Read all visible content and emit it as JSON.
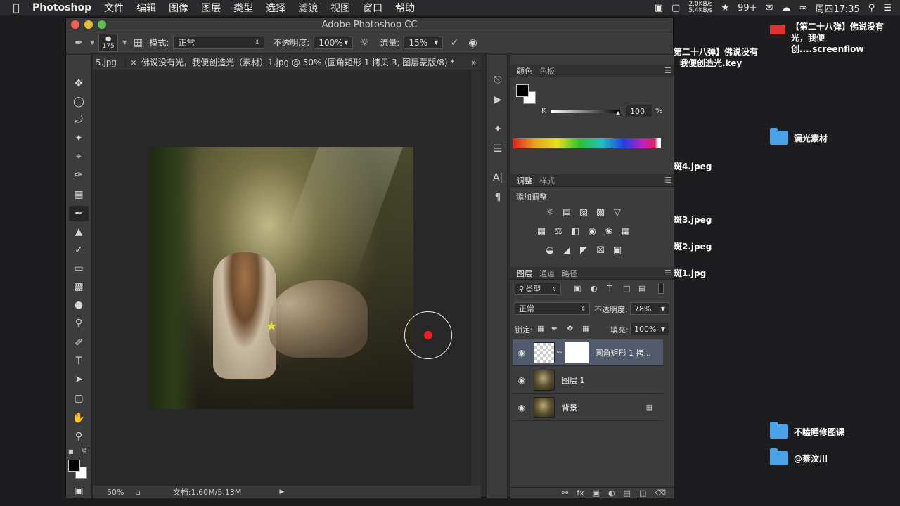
{
  "menubar": {
    "app_name": "Photoshop",
    "items": [
      "文件",
      "编辑",
      "图像",
      "图层",
      "类型",
      "选择",
      "滤镜",
      "视图",
      "窗口",
      "帮助"
    ],
    "net_up": "2.0KB/s",
    "net_down": "5.4KB/s",
    "badge": "99+",
    "clock": "周四17:35"
  },
  "desktop": {
    "file_top": "【第二十八弹】佛说没有光，我便创....screenflow",
    "file_key_line1": "第二十八弹】佛说没有",
    "file_key_line2": "我便创造光.key",
    "folder1": "漏光素材",
    "file4": "斑4.jpeg",
    "file3": "斑3.jpeg",
    "file2": "斑2.jpeg",
    "file1": "斑1.jpg",
    "folder2": "不瞌睡修图课",
    "folder3": "@蔡汶川"
  },
  "window": {
    "title": "Adobe Photoshop CC"
  },
  "options": {
    "brush_size": "175",
    "mode_label": "模式:",
    "mode_value": "正常",
    "opacity_label": "不透明度:",
    "opacity_value": "100%",
    "flow_label": "流量:",
    "flow_value": "15%"
  },
  "document": {
    "prev_tab": "5.jpg",
    "active_tab": "佛说没有光，我便创造光（素材）1.jpg @ 50% (圆角矩形 1 拷贝 3, 图层蒙版/8) *",
    "zoom": "50%",
    "doc_info": "文档:1.60M/5.13M"
  },
  "color_panel": {
    "tab_color": "颜色",
    "tab_swatches": "色板",
    "channel_label": "K",
    "channel_value": "100",
    "channel_unit": "%",
    "fg_color": "#000000",
    "bg_color": "#ffffff"
  },
  "adjust_panel": {
    "tab_adjust": "调整",
    "tab_styles": "样式",
    "add_label": "添加调整"
  },
  "layers_panel": {
    "tab_layers": "图层",
    "tab_channels": "通道",
    "tab_paths": "路径",
    "filter_label": "类型",
    "blend_mode": "正常",
    "opacity_label": "不透明度:",
    "opacity_value": "78%",
    "lock_label": "锁定:",
    "fill_label": "填充:",
    "fill_value": "100%",
    "layers": [
      {
        "name": "圆角矩形 1 拷...",
        "selected": true
      },
      {
        "name": "图层 1",
        "selected": false
      },
      {
        "name": "背景",
        "selected": false
      }
    ]
  }
}
